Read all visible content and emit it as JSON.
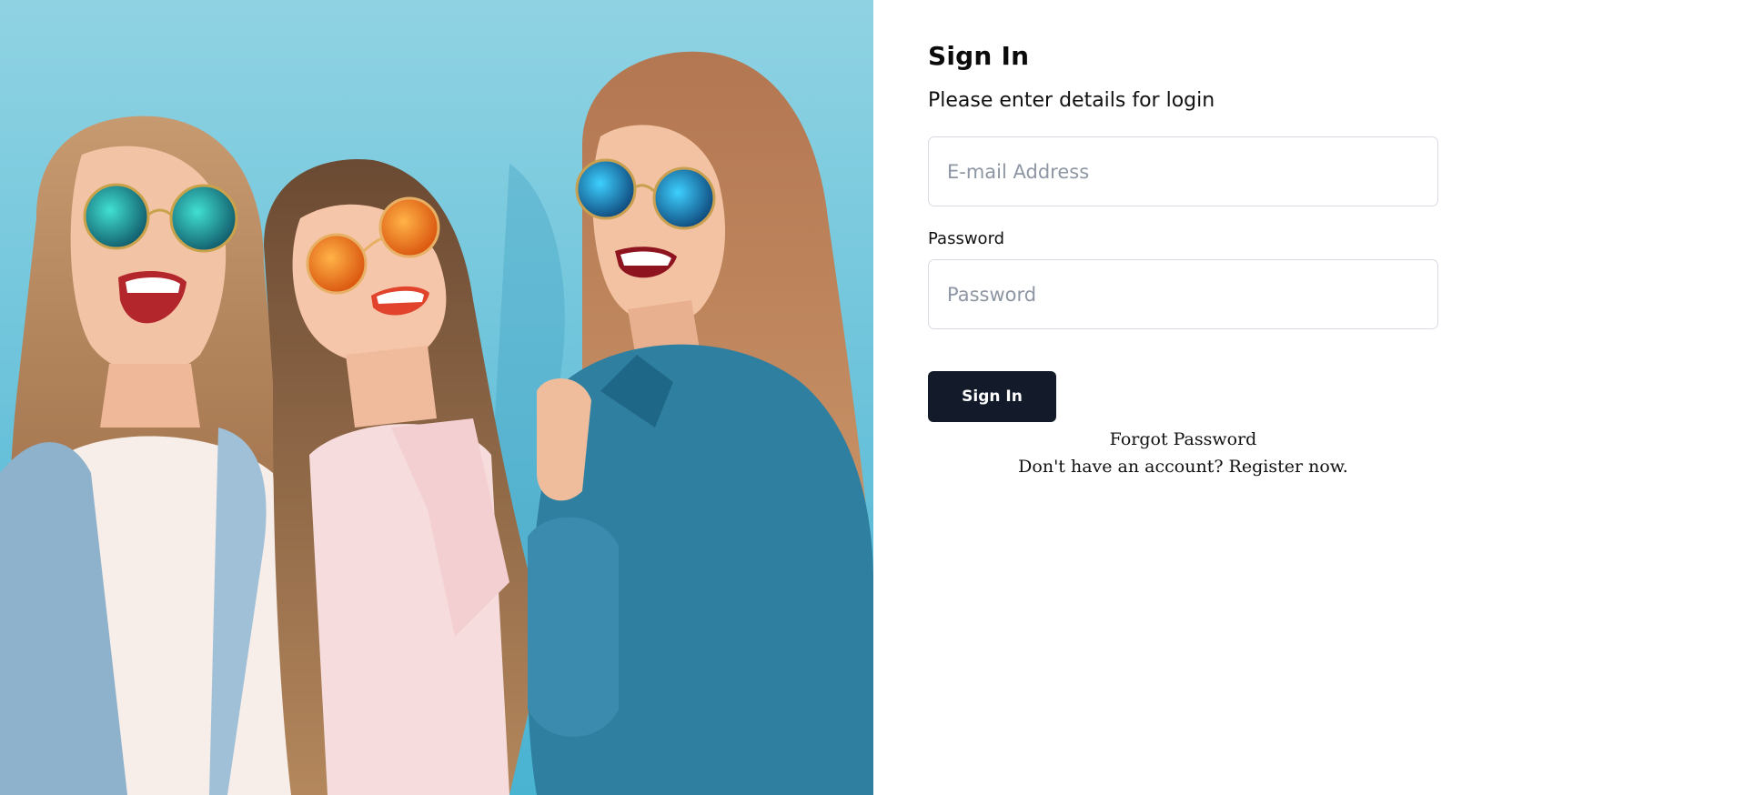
{
  "hero": {
    "image_description_icon": "photo-three-women-sunglasses"
  },
  "form": {
    "title": "Sign In",
    "subtitle": "Please enter details for login",
    "email": {
      "placeholder": "E-mail Address",
      "value": ""
    },
    "password": {
      "label": "Password",
      "placeholder": "Password",
      "value": ""
    },
    "submit_label": "Sign In",
    "forgot_password": "Forgot Password",
    "register_prompt": "Don't have an account? Register now."
  },
  "colors": {
    "button_bg": "#131b2b",
    "hero_bg": "#61c3dc",
    "input_border": "#d7dce3"
  }
}
